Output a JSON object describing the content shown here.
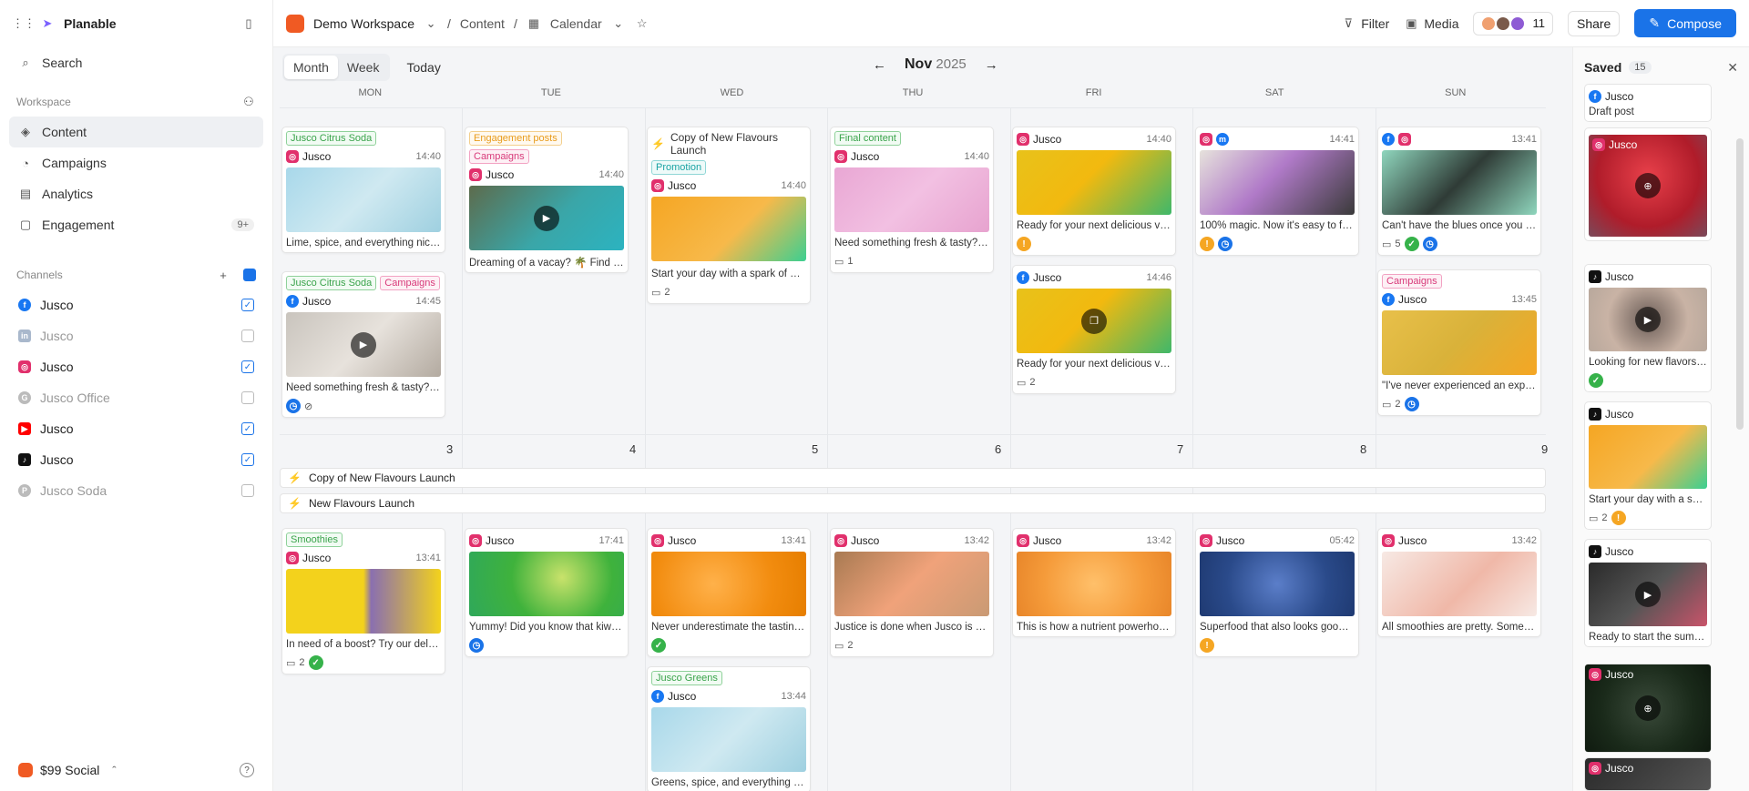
{
  "app": {
    "name": "Planable"
  },
  "sidebar": {
    "search_label": "Search",
    "workspace_section": "Workspace",
    "nav": [
      {
        "label": "Content",
        "icon": "layers-icon",
        "active": true
      },
      {
        "label": "Campaigns",
        "icon": "megaphone-icon"
      },
      {
        "label": "Analytics",
        "icon": "bar-chart-icon"
      },
      {
        "label": "Engagement",
        "icon": "chat-icon",
        "badge": "9+"
      }
    ],
    "channels_section": "Channels",
    "channels": [
      {
        "label": "Jusco",
        "network": "facebook",
        "checked": true
      },
      {
        "label": "Jusco",
        "network": "linkedin",
        "checked": false
      },
      {
        "label": "Jusco",
        "network": "instagram",
        "checked": true
      },
      {
        "label": "Jusco Office",
        "network": "google",
        "checked": false
      },
      {
        "label": "Jusco",
        "network": "youtube",
        "checked": true
      },
      {
        "label": "Jusco",
        "network": "tiktok",
        "checked": true
      },
      {
        "label": "Jusco Soda",
        "network": "pinterest",
        "checked": false
      }
    ],
    "plan_label": "$99 Social"
  },
  "topbar": {
    "workspace": "Demo Workspace",
    "crumb_content": "Content",
    "crumb_view": "Calendar",
    "filter_label": "Filter",
    "media_label": "Media",
    "members_count": "11",
    "share_label": "Share",
    "compose_label": "Compose"
  },
  "calendar": {
    "views": {
      "month": "Month",
      "week": "Week"
    },
    "today_label": "Today",
    "month": "Nov",
    "year": "2025",
    "weekdays": [
      "MON",
      "TUE",
      "WED",
      "THU",
      "FRI",
      "SAT",
      "SUN"
    ],
    "week2_days": [
      "3",
      "4",
      "5",
      "6",
      "7",
      "8",
      "9"
    ],
    "campaign_bars": [
      "Copy of New Flavours Launch",
      "New Flavours Launch"
    ],
    "week1": {
      "mon1": {
        "tags": [
          "Jusco Citrus Soda"
        ],
        "account": "Jusco",
        "time": "14:40",
        "text": "Lime, spice, and everything nice ..."
      },
      "mon2": {
        "tags": [
          "Jusco Citrus Soda",
          "Campaigns"
        ],
        "account": "Jusco",
        "time": "14:45",
        "text": "Need something fresh & tasty? ..."
      },
      "tue1": {
        "tags": [
          "Engagement posts",
          "Campaigns"
        ],
        "account": "Jusco",
        "time": "14:40",
        "text": "Dreaming of a vacay? 🌴 Find ou..."
      },
      "wed1": {
        "campaign": "Copy of New Flavours Launch",
        "tags": [
          "Promotion"
        ],
        "account": "Jusco",
        "time": "14:40",
        "text": "Start your day with a spark of 🍊...",
        "comments": "2"
      },
      "thu1": {
        "tags": [
          "Final content"
        ],
        "account": "Jusco",
        "time": "14:40",
        "text": "Need something fresh & tasty? ...",
        "comments": "1"
      },
      "fri1": {
        "account": "Jusco",
        "time": "14:40",
        "text": "Ready for your next delicious vaca..."
      },
      "fri2": {
        "account": "Jusco",
        "time": "14:46",
        "text": "Ready for your next delicious vaca...",
        "comments": "2"
      },
      "sat1": {
        "time": "14:41",
        "text": "100% magic. Now it's easy to feel ..."
      },
      "sun1": {
        "time": "13:41",
        "text": "Can't have the blues once you tas...",
        "comments": "5"
      },
      "sun2": {
        "tags": [
          "Campaigns"
        ],
        "account": "Jusco",
        "time": "13:45",
        "text": "\"I've never experienced an explosi...",
        "comments": "2"
      }
    },
    "week2": {
      "mon": {
        "tags": [
          "Smoothies"
        ],
        "account": "Jusco",
        "time": "13:41",
        "text": "In need of a boost? Try our delicio...",
        "comments": "2"
      },
      "tue": {
        "account": "Jusco",
        "time": "17:41",
        "text": "Yummy! Did you know that kiwi is..."
      },
      "wed": {
        "account": "Jusco",
        "time": "13:41",
        "text": "Never underestimate the tastiness..."
      },
      "wed2": {
        "tags": [
          "Jusco Greens"
        ],
        "account": "Jusco",
        "time": "13:44",
        "text": "Greens, spice, and everything nice..."
      },
      "thu": {
        "account": "Jusco",
        "time": "13:42",
        "text": "Justice is done when Jusco is serv...",
        "comments": "2"
      },
      "fri": {
        "account": "Jusco",
        "time": "13:42",
        "text": "This is how a nutrient powerhous..."
      },
      "sat": {
        "account": "Jusco",
        "time": "05:42",
        "text": "Superfood that also looks good? ..."
      },
      "sun": {
        "account": "Jusco",
        "time": "13:42",
        "text": "All smoothies are pretty. Some ar..."
      }
    }
  },
  "saved": {
    "title": "Saved",
    "count": "15",
    "items": [
      {
        "account": "Jusco",
        "text": "Draft post"
      },
      {
        "account": "Jusco"
      },
      {
        "account": "Jusco",
        "text": "Looking for new flavors. ..."
      },
      {
        "account": "Jusco",
        "text": "Start your day with a spa...",
        "comments": "2"
      },
      {
        "account": "Jusco",
        "text": "Ready to start the summ..."
      },
      {
        "account": "Jusco"
      },
      {
        "account": "Jusco"
      }
    ]
  },
  "colors": {
    "accent": "#1a73e8",
    "brand": "#f05a23"
  }
}
